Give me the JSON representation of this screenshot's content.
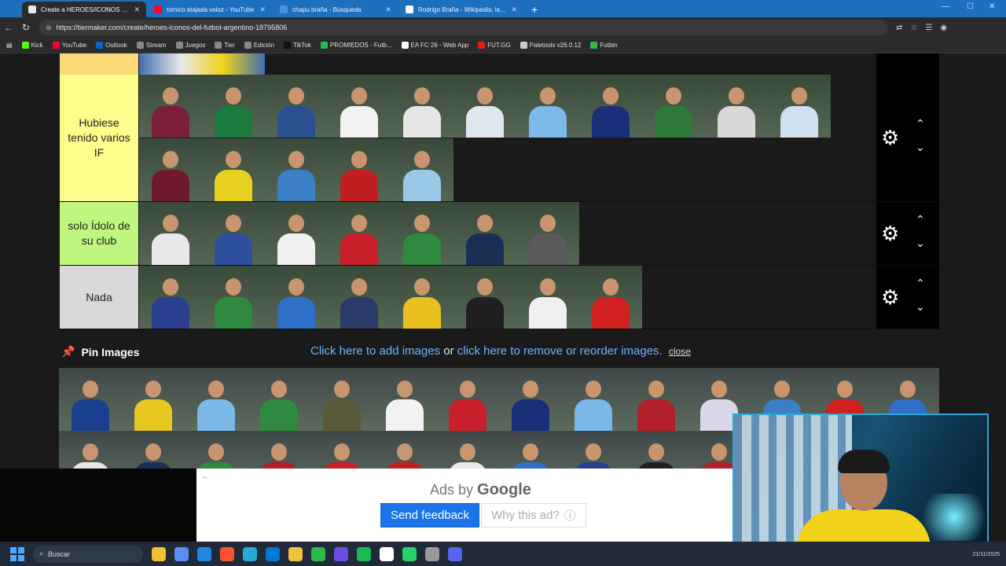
{
  "browser": {
    "tabs": [
      {
        "label": "Create a HEROES/ICONOS del FÚ",
        "color": "#e8e8e8",
        "active": true
      },
      {
        "label": "tomico atajada veloz - YouTube",
        "color": "#ff0033",
        "active": false
      },
      {
        "label": "chapu braña - Búsqueda",
        "color": "#4a90e2",
        "active": false
      },
      {
        "label": "Rodrigo Braña - Wikipedia, la enc",
        "color": "#ffffff",
        "active": false
      }
    ],
    "new_tab": "+",
    "url": "https://tiermaker.com/create/heroes-iconos-del-futbol-argentino-18795806"
  },
  "bookmarks": [
    {
      "label": "Kick",
      "color": "#53fc18"
    },
    {
      "label": "YouTube",
      "color": "#ff0033"
    },
    {
      "label": "Outlook",
      "color": "#0a64c8"
    },
    {
      "label": "Stream",
      "color": "#888888"
    },
    {
      "label": "Juegos",
      "color": "#888888"
    },
    {
      "label": "Tier",
      "color": "#888888"
    },
    {
      "label": "Edición",
      "color": "#888888"
    },
    {
      "label": "TikTok",
      "color": "#111111"
    },
    {
      "label": "PROMIEDOS - Futb...",
      "color": "#2db84c"
    },
    {
      "label": "EA FC 26 - Web App",
      "color": "#ffffff"
    },
    {
      "label": "FUT.GG",
      "color": "#e02020"
    },
    {
      "label": "Paletools v26.0.12",
      "color": "#cccccc"
    },
    {
      "label": "Futbin",
      "color": "#2fb84c"
    }
  ],
  "tiers": [
    {
      "label": "Hubiese tenido varios IF",
      "color": "#fdfd8c",
      "rows": 2,
      "tiles": [
        "#7b1f3a",
        "#1b7a3e",
        "#2a4f8f",
        "#f2f2f2",
        "#e6e6e6",
        "#dfe6ee",
        "#7db9e8",
        "#1a2f7a",
        "#2f7a3a",
        "#d8d8d8",
        "#cfe0ee",
        "#6e1a2a",
        "#e8d020",
        "#3b7fc7",
        "#c11f1f",
        "#9cc8e8"
      ]
    },
    {
      "label": "solo Ídolo de su club",
      "color": "#bff67f",
      "rows": 1,
      "tiles": [
        "#e8e8e8",
        "#2d4f9e",
        "#f0f0f0",
        "#c81f2a",
        "#2f8a3f",
        "#1b2f55",
        "#5a5a5a"
      ]
    },
    {
      "label": "Nada",
      "color": "#d9d9d9",
      "rows": 1,
      "tiles": [
        "#2a3f8f",
        "#2f8a3f",
        "#2f6fc7",
        "#2b3a66",
        "#e8c020",
        "#202020",
        "#f0f0f0",
        "#d02020"
      ]
    }
  ],
  "pin": {
    "title": "Pin Images",
    "add_link": "Click here to add images",
    "or": " or ",
    "remove_link": "click here to remove or reorder images.",
    "close": "close"
  },
  "pool": [
    "#1b3f8f",
    "#e8c820",
    "#7ab8e8",
    "#2f8a3f",
    "#5a5a3a",
    "#f2f2f2",
    "#c81f2a",
    "#1a2f7a",
    "#7ab8e8",
    "#b01f2a",
    "#d8d8e8",
    "#3b7fc7",
    "#d02020",
    "#2f6fc7",
    "#e8e8e8",
    "#1b2f55",
    "#2f8a3f",
    "#b01f2a",
    "#c81f2a",
    "#c01f1f",
    "#e8e8e8",
    "#2f6fc7",
    "#2a3f8f",
    "#202020",
    "#b01f2a"
  ],
  "ad": {
    "ads_by": "Ads by ",
    "google": "Google",
    "feedback": "Send feedback",
    "why": "Why this ad?"
  },
  "taskbar": {
    "search": "Buscar",
    "apps": [
      "#f2c12e",
      "#5b8def",
      "#1e88e5",
      "#fb542b",
      "#2aa9d6",
      "#0078d4",
      "#f0c040",
      "#2fb84c",
      "#6b4de6",
      "#1db954",
      "#ffffff",
      "#25d366",
      "#999999",
      "#5865f2"
    ],
    "date": "21/11/2025"
  }
}
